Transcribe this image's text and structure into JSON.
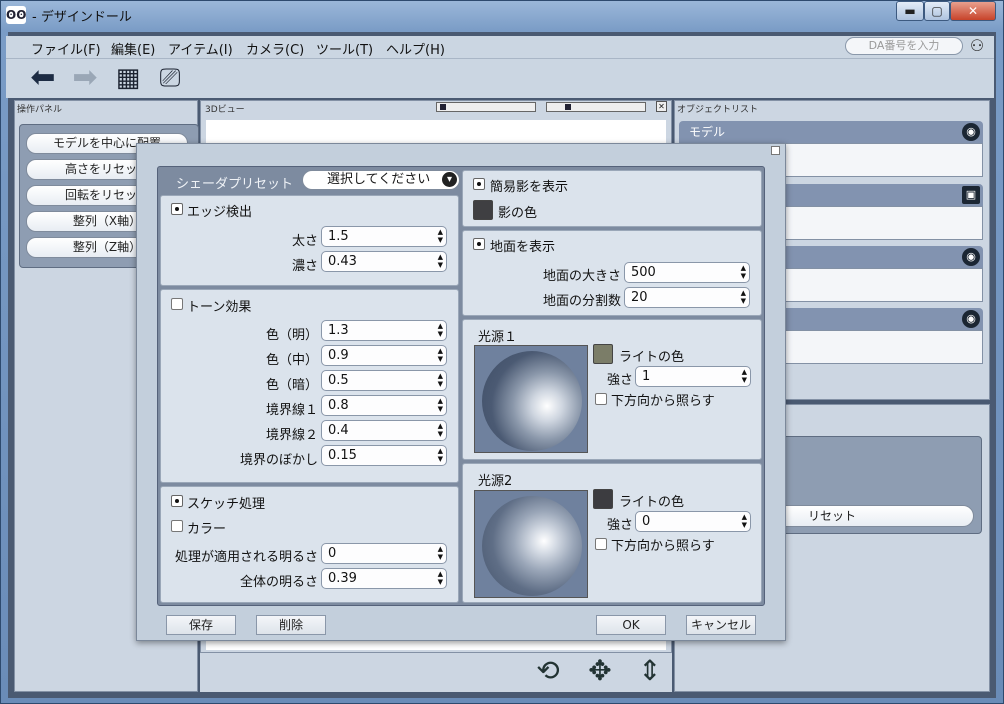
{
  "window": {
    "title": "- デザインドール",
    "icon": "doll-app-icon",
    "minimize": "▬",
    "maximize": "▢",
    "close": "✕"
  },
  "menu": [
    "ファイル(F)",
    "編集(E)",
    "アイテム(I)",
    "カメラ(C)",
    "ツール(T)",
    "ヘルプ(H)"
  ],
  "da_input": {
    "placeholder": "DA番号を入力"
  },
  "panels": {
    "left_label": "操作パネル",
    "center_label": "3Dビュー",
    "right_label": "オブジェクトリスト"
  },
  "left_buttons": [
    "モデルを中心に配置",
    "高さをリセット",
    "回転をリセット",
    "整列（X軸）",
    "整列（Z軸）"
  ],
  "objects": [
    {
      "label": "モデル",
      "icon": "camera-round-icon"
    },
    {
      "label": "",
      "icon": "movie-camera-icon"
    },
    {
      "label": "",
      "icon": "camera-round-icon"
    },
    {
      "label": "",
      "icon": "camera-round-icon"
    }
  ],
  "right_lower": {
    "reset_label": "リセット"
  },
  "dialog": {
    "preset_label": "シェーダプリセット",
    "preset_select": "選択してください",
    "edge": {
      "label": "エッジ検出",
      "checked": true,
      "fields": [
        {
          "label": "太さ",
          "value": "1.5"
        },
        {
          "label": "濃さ",
          "value": "0.43"
        }
      ]
    },
    "toon": {
      "label": "トーン効果",
      "checked": false,
      "fields": [
        {
          "label": "色（明）",
          "value": "1.3"
        },
        {
          "label": "色（中）",
          "value": "0.9"
        },
        {
          "label": "色（暗）",
          "value": "0.5"
        },
        {
          "label": "境界線１",
          "value": "0.8"
        },
        {
          "label": "境界線２",
          "value": "0.4"
        },
        {
          "label": "境界のぼかし",
          "value": "0.15"
        }
      ]
    },
    "sketch": {
      "label": "スケッチ処理",
      "checked": true,
      "color_label": "カラー",
      "color_checked": false,
      "fields": [
        {
          "label": "処理が適用される明るさ",
          "value": "0"
        },
        {
          "label": "全体の明るさ",
          "value": "0.39"
        }
      ]
    },
    "shadow": {
      "label": "簡易影を表示",
      "checked": true,
      "color_label": "影の色",
      "color": "#3f3f42"
    },
    "ground": {
      "label": "地面を表示",
      "checked": true,
      "fields": [
        {
          "label": "地面の大きさ",
          "value": "500"
        },
        {
          "label": "地面の分割数",
          "value": "20"
        }
      ]
    },
    "light1": {
      "title": "光源１",
      "color_label": "ライトの色",
      "color": "#7b7d68",
      "strength_label": "強さ",
      "strength": "1",
      "below_label": "下方向から照らす",
      "below_checked": false
    },
    "light2": {
      "title": "光源2",
      "color_label": "ライトの色",
      "color": "#3c3c40",
      "strength_label": "強さ",
      "strength": "0",
      "below_label": "下方向から照らす",
      "below_checked": false
    },
    "buttons": {
      "save": "保存",
      "delete": "削除",
      "ok": "OK",
      "cancel": "キャンセル"
    }
  }
}
